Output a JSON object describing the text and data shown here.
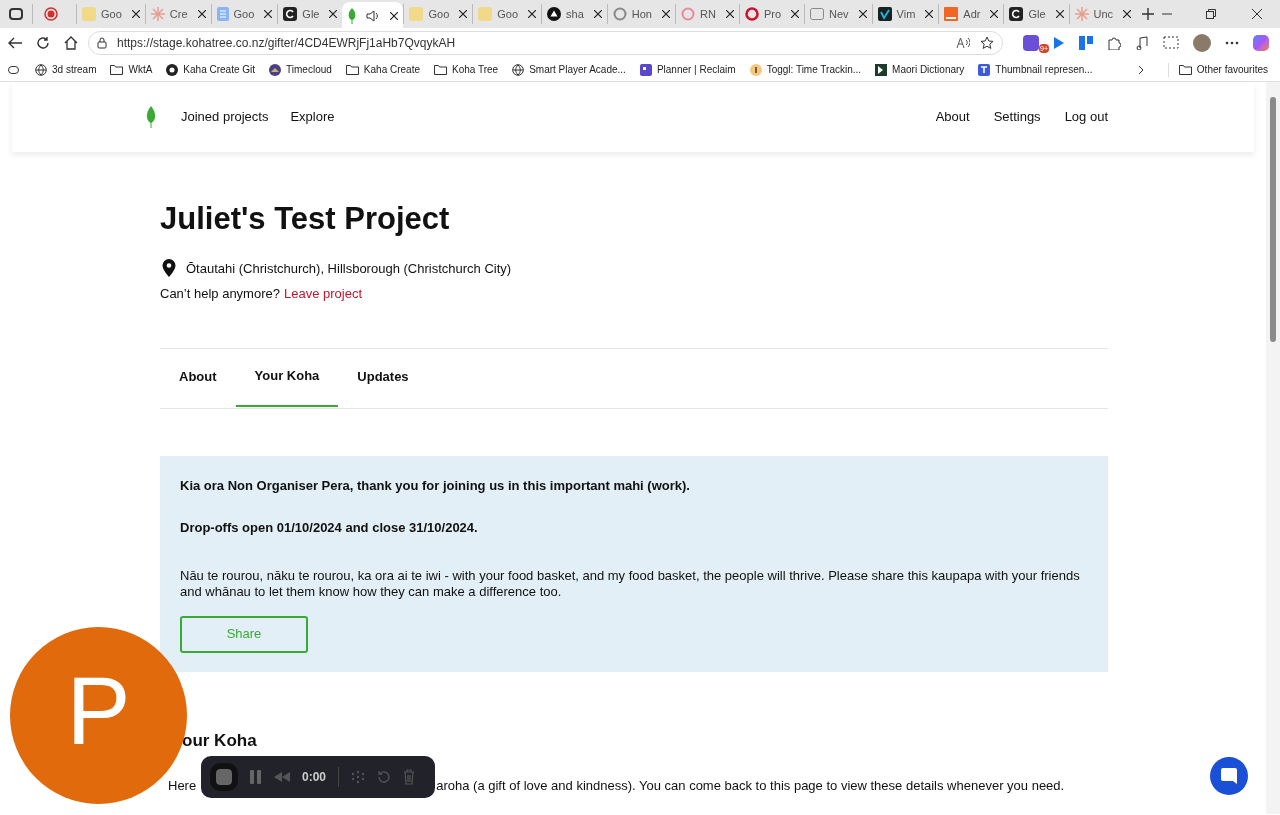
{
  "browser_tabs": [
    {
      "selected": false
    },
    {
      "title": "Goo",
      "selected": false
    },
    {
      "title": "Cre",
      "selected": false
    },
    {
      "title": "Goo",
      "selected": false
    },
    {
      "title": "Gle",
      "selected": false
    },
    {
      "selected": true
    },
    {
      "title": "Goo",
      "selected": false
    },
    {
      "title": "Goo",
      "selected": false
    },
    {
      "title": "sha",
      "selected": false
    },
    {
      "title": "Hon",
      "selected": false
    },
    {
      "title": "RN",
      "selected": false
    },
    {
      "title": "Pro",
      "selected": false
    },
    {
      "title": "Nev",
      "selected": false
    },
    {
      "title": "Vim",
      "selected": false
    },
    {
      "title": "Adr",
      "selected": false
    },
    {
      "title": "Gle",
      "selected": false
    },
    {
      "title": "Unc",
      "selected": false
    }
  ],
  "address_bar": {
    "url": "https://stage.kohatree.co.nz/gifter/4CD4EWRjFj1aHb7QvqykAH"
  },
  "profile_badge": "9+",
  "bookmarks": [
    {
      "label": "3d stream"
    },
    {
      "label": "WktA"
    },
    {
      "label": "Kaha Create Git"
    },
    {
      "label": "Timecloud"
    },
    {
      "label": "Kaha Create"
    },
    {
      "label": "Koha Tree"
    },
    {
      "label": "Smart Player Acade..."
    },
    {
      "label": "Planner | Reclaim"
    },
    {
      "label": "Toggl: Time Trackin..."
    },
    {
      "label": "Maori Dictionary"
    },
    {
      "label": "Thumbnail represen..."
    }
  ],
  "other_favourites": "Other favourites",
  "site_nav": {
    "left": [
      "Joined projects",
      "Explore"
    ],
    "right": [
      "About",
      "Settings",
      "Log out"
    ]
  },
  "project": {
    "title": "Juliet's Test Project",
    "location": "Ōtautahi (Christchurch), Hillsborough (Christchurch City)",
    "leave_prompt": "Can’t help anymore?",
    "leave_link": "Leave project"
  },
  "project_tabs": [
    {
      "label": "About",
      "selected": false
    },
    {
      "label": "Your Koha",
      "selected": true
    },
    {
      "label": "Updates",
      "selected": false
    }
  ],
  "notice": {
    "greeting": "Kia ora Non Organiser Pera, thank you for joining us in this important mahi (work).",
    "dropoffs": "Drop-offs open 01/10/2024 and close 31/10/2024.",
    "proverb": "Nāu te rourou, nāku te rourou, ka ora ai te iwi - with your food basket, and my food basket, the people will thrive. Please share this kaupapa with your friends and whānau to let them know how they can make a difference too.",
    "share_button": "Share"
  },
  "your_koha": {
    "heading": "our Koha",
    "line_start": "Here",
    "line_end": "aroha (a gift of love and kindness). You can come back to this page to view these details whenever you need."
  },
  "avatar": {
    "letter": "P"
  },
  "recorder": {
    "time": "0:00"
  }
}
